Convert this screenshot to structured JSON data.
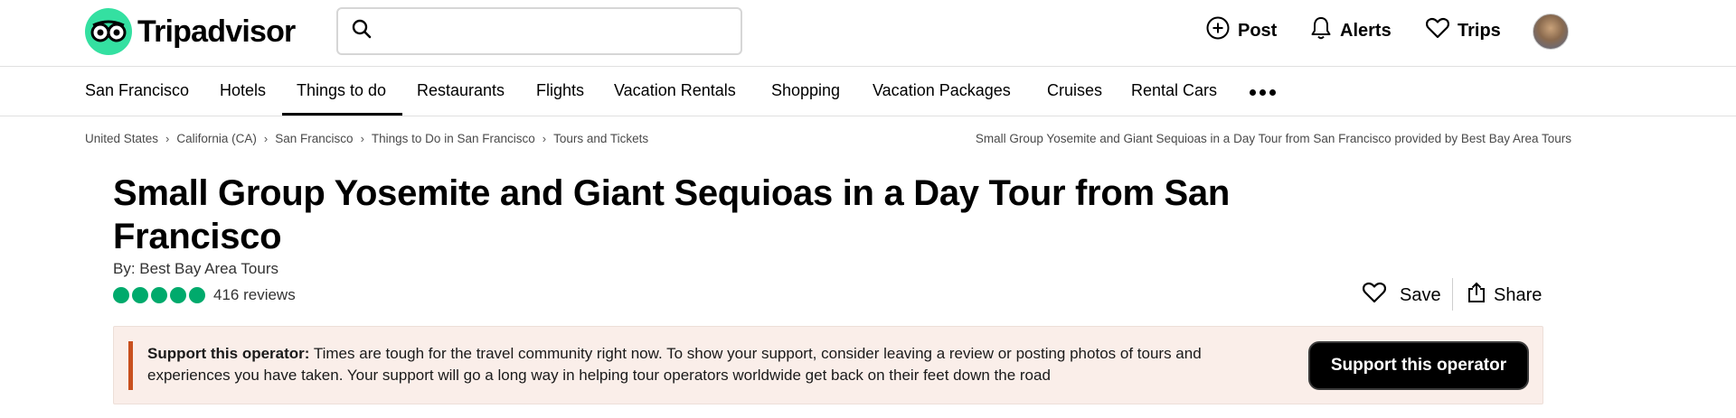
{
  "header": {
    "logo_text": "Tripadvisor",
    "search": {
      "placeholder": "",
      "value": ""
    },
    "actions": [
      {
        "label": "Post",
        "icon": "plus-circle-icon"
      },
      {
        "label": "Alerts",
        "icon": "bell-icon"
      },
      {
        "label": "Trips",
        "icon": "heart-icon"
      }
    ]
  },
  "nav": {
    "items": [
      {
        "label": "San Francisco"
      },
      {
        "label": "Hotels"
      },
      {
        "label": "Things to do",
        "active": true
      },
      {
        "label": "Restaurants"
      },
      {
        "label": "Flights"
      },
      {
        "label": "Vacation Rentals"
      },
      {
        "label": "Shopping"
      },
      {
        "label": "Vacation Packages"
      },
      {
        "label": "Cruises"
      },
      {
        "label": "Rental Cars"
      }
    ],
    "more_icon": "more-dots-icon"
  },
  "breadcrumb": {
    "items": [
      "United States",
      "California (CA)",
      "San Francisco",
      "Things to Do in San Francisco",
      "Tours and Tickets"
    ],
    "right_text": "Small Group Yosemite and Giant Sequioas in a Day Tour from San Francisco provided by Best Bay Area Tours"
  },
  "product": {
    "title": "Small Group Yosemite and Giant Sequioas in a Day Tour from San Francisco",
    "byline": "By: Best Bay Area Tours",
    "rating_bubbles": 5,
    "reviews": "416 reviews",
    "save_label": "Save",
    "share_label": "Share"
  },
  "banner": {
    "bold": "Support this operator:",
    "text": " Times are tough for the travel community right now. To show your support, consider leaving a review or posting photos of tours and experiences you have taken. Your support will go a long way in helping tour operators worldwide get back on their feet down the road",
    "button_label": "Support this operator"
  },
  "colors": {
    "brand_green": "#34e0a1",
    "rating_green": "#00aa6c",
    "banner_bg": "#faeee9",
    "banner_accent": "#c8501e"
  }
}
